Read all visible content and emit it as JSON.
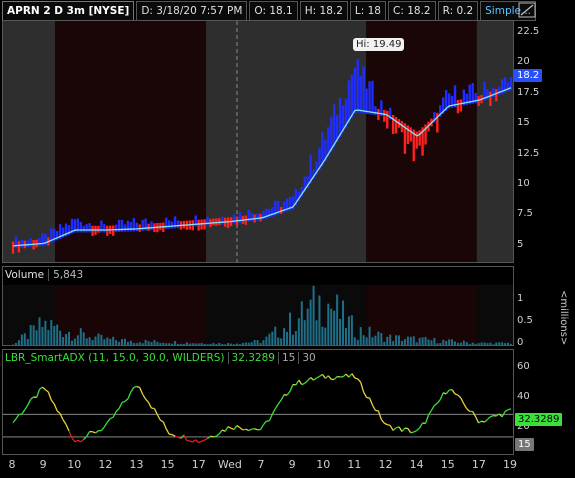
{
  "header": {
    "symbol": "APRN 2 D 3m [NYSE]",
    "date": "D: 3/18/20 7:57 PM",
    "open": "O: 18.1",
    "high": "H: 18.2",
    "low": "L: 18",
    "close": "C: 18.2",
    "range": "R: 0.2",
    "study_set": "Simple..."
  },
  "price_pane": {
    "hi_callout": "Hi: 19.49",
    "current_price": "18.2",
    "y_ticks": [
      "22.5",
      "20",
      "17.5",
      "15",
      "12.5",
      "10",
      "7.5",
      "5"
    ],
    "colors": {
      "up": "#1f2dff",
      "down": "#ff2020",
      "ma": "#7fe6ff",
      "session_dark": "#1a0606",
      "session_light": "#2e2e2e"
    }
  },
  "volume_pane": {
    "title": "Volume",
    "value": "5,843",
    "y_ticks": [
      "1",
      "0.5",
      "0"
    ],
    "unit": "<millions>",
    "color": "#1e6f8a"
  },
  "adx_pane": {
    "title": "LBR_SmartADX (11, 15.0, 30.0, WILDERS)",
    "value": "32.3289",
    "level1": "15",
    "level2": "30",
    "y_ticks": [
      "60",
      "40",
      "20"
    ],
    "colors": {
      "rising": "#3adf3a",
      "falling": "#e8d23a",
      "low": "#e02020"
    }
  },
  "x_axis": [
    "8",
    "9",
    "10",
    "12",
    "13",
    "15",
    "17",
    "Wed",
    "7",
    "9",
    "10",
    "11",
    "12",
    "14",
    "15",
    "17",
    "19"
  ],
  "chart_data": {
    "type": "line",
    "title": "APRN 2 D 3m [NYSE]",
    "categories": [
      "8",
      "9",
      "10",
      "12",
      "13",
      "15",
      "17",
      "Wed",
      "7",
      "9",
      "10",
      "11",
      "12",
      "14",
      "15",
      "17",
      "19"
    ],
    "series": [
      {
        "values": [
          5.0,
          5.3,
          6.8,
          6.2,
          6.6,
          6.7,
          6.9,
          7.1,
          7.6,
          8.5,
          13.5,
          19.49,
          15.5,
          12.5,
          17.0,
          17.2,
          18.2
        ]
      },
      {
        "values": [
          5.0,
          5.2,
          6.3,
          6.3,
          6.4,
          6.6,
          6.8,
          7.0,
          7.3,
          8.2,
          12.0,
          16.2,
          15.8,
          14.0,
          16.5,
          17.0,
          18.0
        ]
      }
    ],
    "ylim": [
      4,
      23
    ],
    "secondary": [
      {
        "name": "Volume",
        "values": [
          0.02,
          0.55,
          0.3,
          0.15,
          0.1,
          0.08,
          0.05,
          0.04,
          0.1,
          0.6,
          1.2,
          0.4,
          0.2,
          0.15,
          0.1,
          0.05,
          0.05
        ],
        "unit": "<millions>"
      },
      {
        "name": "LBR_SmartADX",
        "values": [
          25,
          48,
          12,
          22,
          50,
          18,
          12,
          22,
          20,
          50,
          55,
          55,
          22,
          18,
          48,
          25,
          32.3289
        ]
      }
    ]
  }
}
